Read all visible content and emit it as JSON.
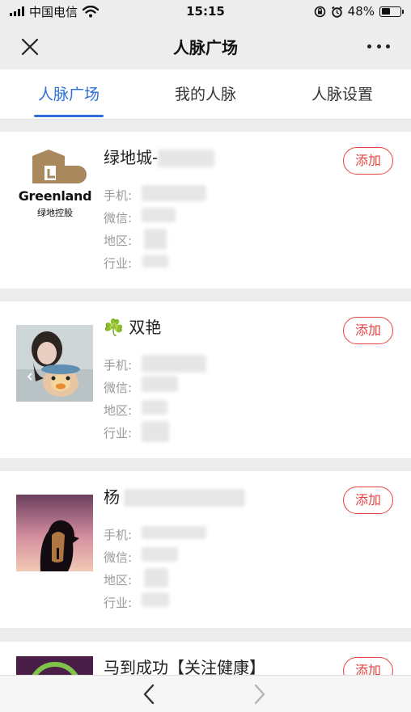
{
  "status_bar": {
    "carrier": "中国电信",
    "time": "15:15",
    "battery_text": "48%",
    "battery_level": 0.48,
    "icons": [
      "signal-icon",
      "wifi-icon",
      "orientation-lock-icon",
      "alarm-icon",
      "battery-icon"
    ]
  },
  "nav": {
    "title": "人脉广场",
    "close_icon": "close-icon",
    "more_icon": "more-icon"
  },
  "tabs": [
    {
      "label": "人脉广场",
      "active": true
    },
    {
      "label": "我的人脉",
      "active": false
    },
    {
      "label": "人脉设置",
      "active": false
    }
  ],
  "fields": {
    "phone": "手机:",
    "wechat": "微信:",
    "region": "地区:",
    "industry": "行业:"
  },
  "cards": [
    {
      "name": "绿地城-",
      "add_label": "添加",
      "logo_text": "Greenland",
      "logo_subtext": "绿地控股"
    },
    {
      "name": "☘️ 双艳",
      "add_label": "添加"
    },
    {
      "name": "杨",
      "add_label": "添加"
    },
    {
      "name": "马到成功【关注健康】",
      "add_label": "添加"
    }
  ],
  "bottom_bar": {
    "back_icon": "back-arrow-icon",
    "forward_icon": "forward-arrow-icon"
  },
  "colors": {
    "accent": "#2d6fd8",
    "add_button": "#e64340",
    "greenland_brown": "#a8885c"
  }
}
